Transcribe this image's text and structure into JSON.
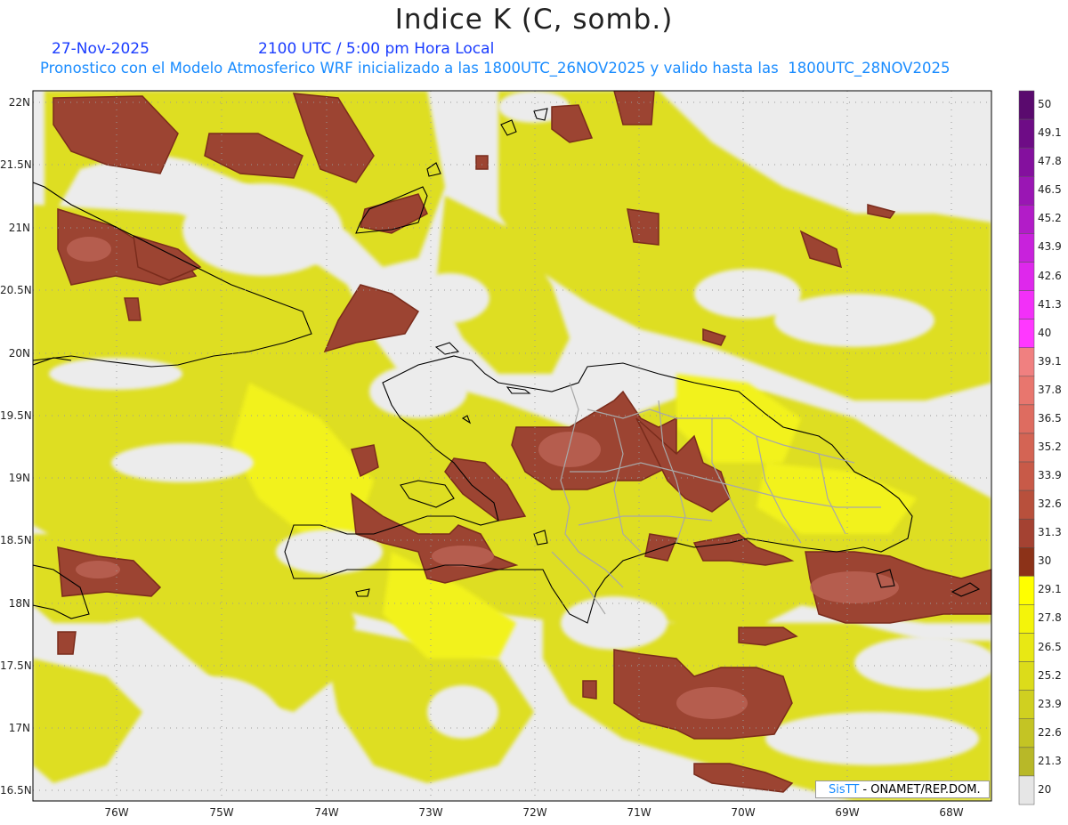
{
  "header": {
    "title": "Indice K (C, somb.)",
    "date": "27-Nov-2025",
    "time": "2100 UTC / 5:00 pm Hora Local",
    "subtitle": "Pronostico con el Modelo Atmosferico WRF inicializado a las 1800UTC_26NOV2025 y valido hasta las  1800UTC_28NOV2025"
  },
  "axes": {
    "lat_labels": [
      "22N",
      "21.5N",
      "21N",
      "20.5N",
      "20N",
      "19.5N",
      "19N",
      "18.5N",
      "18N",
      "17.5N",
      "17N",
      "16.5N"
    ],
    "lon_labels": [
      "76W",
      "75W",
      "74W",
      "73W",
      "72W",
      "71W",
      "70W",
      "69W",
      "68W"
    ]
  },
  "colorbar": {
    "labels": [
      "50",
      "49.1",
      "47.8",
      "46.5",
      "45.2",
      "43.9",
      "42.6",
      "41.3",
      "40",
      "39.1",
      "37.8",
      "36.5",
      "35.2",
      "33.9",
      "32.6",
      "31.3",
      "30",
      "29.1",
      "27.8",
      "26.5",
      "25.2",
      "23.9",
      "22.6",
      "21.3",
      "20"
    ],
    "colors": [
      "#5a0a6e",
      "#6e0c86",
      "#84109e",
      "#9a16b4",
      "#b21cc8",
      "#c822dc",
      "#de28ec",
      "#f230f8",
      "#ff38ff",
      "#f08080",
      "#e8766e",
      "#de6c60",
      "#d46454",
      "#c85a48",
      "#b8503c",
      "#a44232",
      "#8c3218",
      "#ffff00",
      "#f4f40a",
      "#e8e814",
      "#dcdc1a",
      "#d0d020",
      "#c4c424",
      "#b8b828",
      "#e6e6e6"
    ]
  },
  "legend_colors": {
    "land_bg": "#ececec",
    "yellow": "#e8e81c",
    "brown": "#9c4432",
    "border": "#000000",
    "province": "#a8a8a8"
  },
  "credit": {
    "brand": "SisTT",
    "org": " - ONAMET/REP.DOM."
  }
}
